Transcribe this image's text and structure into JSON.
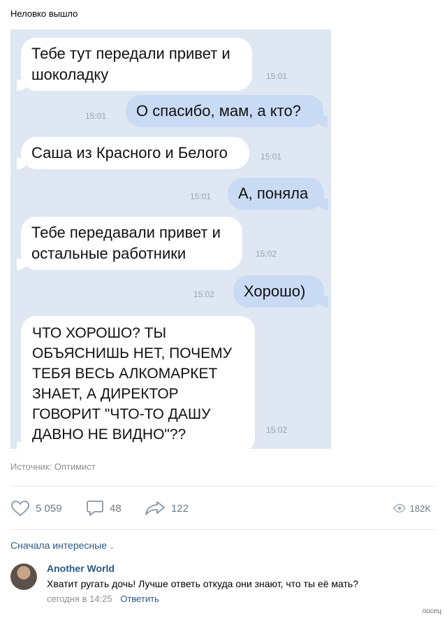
{
  "post": {
    "title": "Неловко вышло",
    "source": "Источник: Оптимист"
  },
  "messages": [
    {
      "side": "in",
      "text": "Тебе тут передали привет и шоколадку",
      "time": "15:01"
    },
    {
      "side": "out",
      "text": "О спасибо, мам, а кто?",
      "time": "15:01"
    },
    {
      "side": "in",
      "text": "Саша из Красного и Белого",
      "time": "15:01"
    },
    {
      "side": "out",
      "text": "А, поняла",
      "time": "15:01"
    },
    {
      "side": "in",
      "text": "Тебе передавали привет и остальные работники",
      "time": "15:02"
    },
    {
      "side": "out",
      "text": "Хорошо)",
      "time": "15:02"
    },
    {
      "side": "in",
      "text": "ЧТО ХОРОШО? ТЫ ОБЪЯСНИШЬ НЕТ, ПОЧЕМУ ТЕБЯ ВЕСЬ АЛКОМАРКЕТ ЗНАЕТ, А ДИРЕКТОР ГОВОРИТ \"ЧТО-ТО ДАШУ ДАВНО НЕ ВИДНО\"??",
      "time": "15:02"
    }
  ],
  "actions": {
    "likes": "5 059",
    "comments": "48",
    "shares": "122",
    "views": "182K"
  },
  "comments_sort": "Сначала интересные",
  "comment": {
    "author": "Another World",
    "text": "Хватит ругать дочь! Лучше ответь откуда они знают, что ты её мать?",
    "time": "сегодня в 14:25",
    "reply": "Ответить"
  },
  "watermark": "писец",
  "colors": {
    "chat_bg": "#dfe7f3",
    "in_bubble": "#ffffff",
    "out_bubble": "#c9daf4",
    "link": "#2a5885"
  },
  "icons": {
    "like": "heart-icon",
    "comment": "comment-icon",
    "share": "share-icon",
    "views": "eye-icon"
  }
}
